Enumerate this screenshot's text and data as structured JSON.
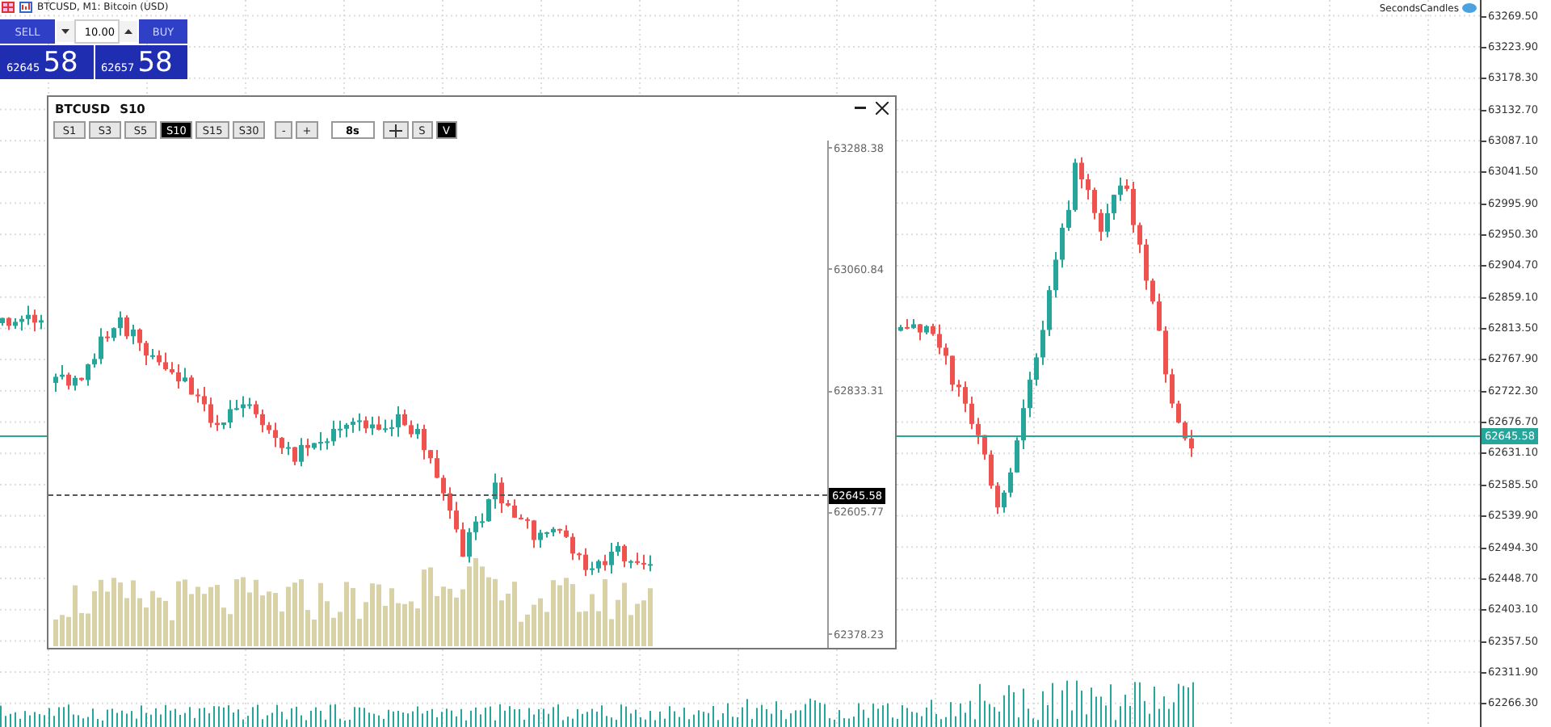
{
  "chart_header": {
    "symbol_line": "BTCUSD, M1:  Bitcoin (USD)"
  },
  "trade_panel": {
    "sell_label": "SELL",
    "buy_label": "BUY",
    "volume": "10.00",
    "sell_price_small": "62645",
    "sell_price_big": "58",
    "buy_price_small": "62657",
    "buy_price_big": "58"
  },
  "indicator_label": "SecondsCandles",
  "price_axis": {
    "labels": [
      "63269.50",
      "63223.90",
      "63178.30",
      "63132.70",
      "63087.10",
      "63041.50",
      "62995.90",
      "62950.30",
      "62904.70",
      "62859.10",
      "62813.50",
      "62767.90",
      "62722.30",
      "62676.70",
      "62631.10",
      "62585.50",
      "62539.90",
      "62494.30",
      "62448.70",
      "62403.10",
      "62357.50",
      "62311.90",
      "62266.30"
    ],
    "current_price": "62645.58"
  },
  "seconds_window": {
    "symbol": "BTCUSD",
    "timeframe": "S10",
    "timeframes": [
      {
        "label": "S1",
        "selected": false
      },
      {
        "label": "S3",
        "selected": false
      },
      {
        "label": "S5",
        "selected": false
      },
      {
        "label": "S10",
        "selected": true
      },
      {
        "label": "S15",
        "selected": false
      },
      {
        "label": "S30",
        "selected": false
      }
    ],
    "zoom_buttons": [
      "-",
      "+"
    ],
    "countdown": "8s",
    "toggles": [
      {
        "kind": "crosshair",
        "selected": false
      },
      {
        "kind": "text",
        "label": "S",
        "selected": false
      },
      {
        "kind": "text",
        "label": "V",
        "selected": true
      }
    ],
    "axis_labels": [
      "63288.38",
      "63060.84",
      "62833.31",
      "62605.77",
      "62378.23"
    ],
    "current_price": "62645.58"
  }
}
